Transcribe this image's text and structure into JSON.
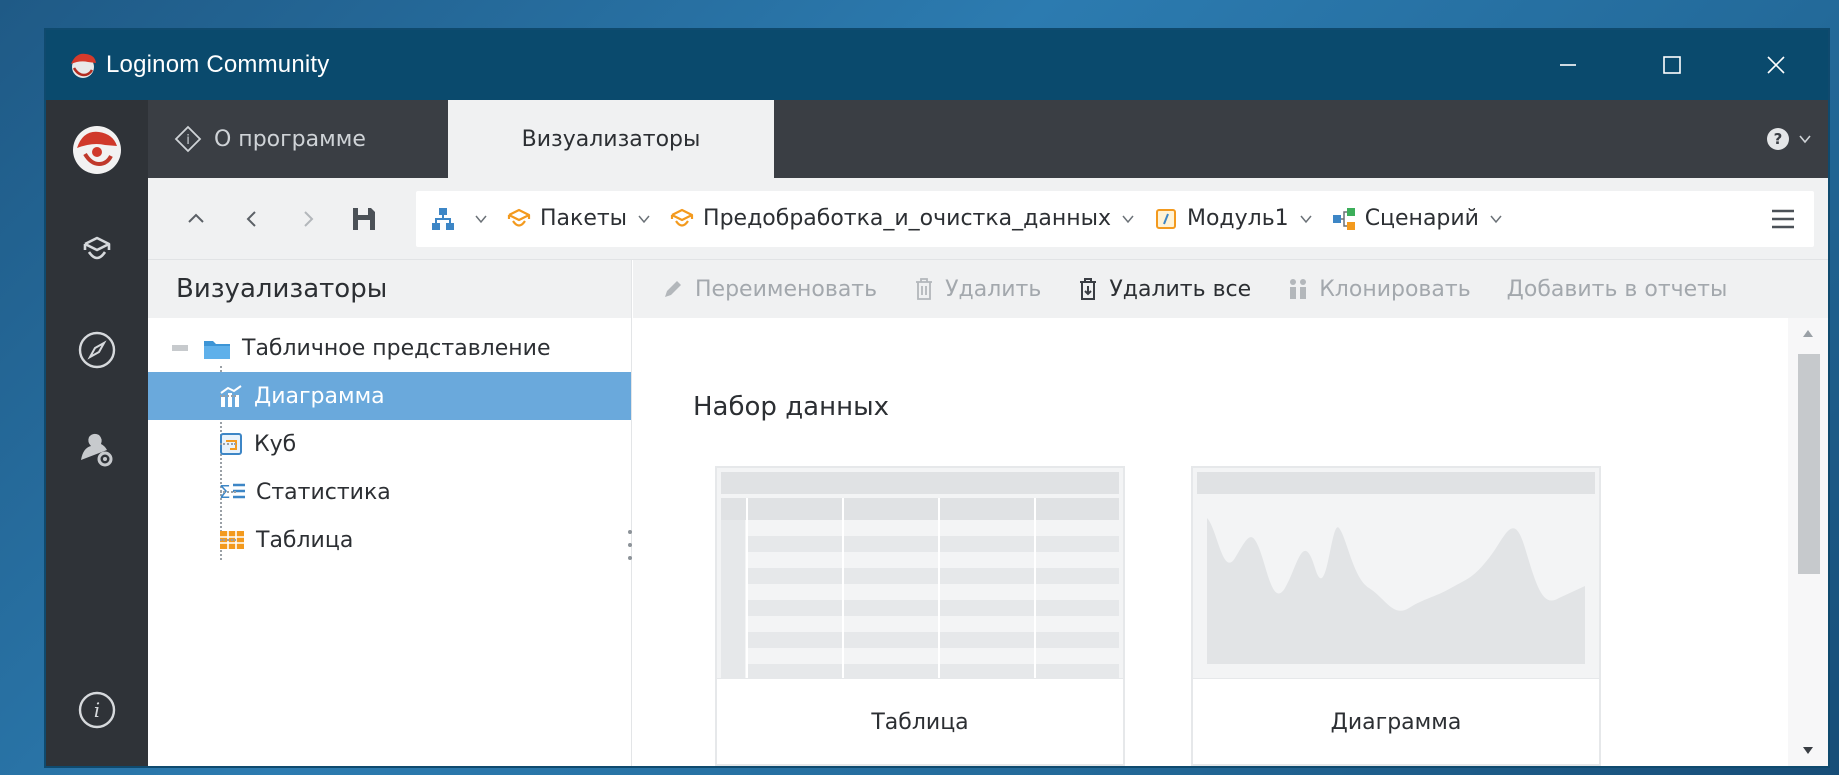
{
  "window": {
    "title": "Loginom Community",
    "controls": {
      "minimize_icon": "minimize-icon",
      "maximize_icon": "maximize-icon",
      "close_icon": "close-icon"
    }
  },
  "rail": {
    "items": [
      {
        "name": "user-avatar",
        "icon": "avatar-icon"
      },
      {
        "name": "packages",
        "icon": "package-icon"
      },
      {
        "name": "navigator",
        "icon": "compass-icon"
      },
      {
        "name": "admin",
        "icon": "user-settings-icon"
      }
    ],
    "bottom": {
      "name": "info",
      "icon": "info-icon"
    }
  },
  "tabs": [
    {
      "label": "О программе",
      "icon": "info-diamond-icon",
      "active": false
    },
    {
      "label": "Визуализаторы",
      "active": true
    }
  ],
  "toolbar": {
    "nav": [
      "up",
      "back",
      "forward",
      "save"
    ],
    "breadcrumbs": [
      {
        "label": "",
        "icon": "hierarchy-icon"
      },
      {
        "label": "Пакеты",
        "icon": "package-icon"
      },
      {
        "label": "Предобработка_и_очистка_данных",
        "icon": "package-icon"
      },
      {
        "label": "Модуль1",
        "icon": "module-icon"
      },
      {
        "label": "Сценарий",
        "icon": "scenario-icon"
      }
    ]
  },
  "left_panel": {
    "title": "Визуализаторы",
    "tree": {
      "root": {
        "label": "Табличное представление",
        "icon": "folder-icon",
        "expanded": true
      },
      "children": [
        {
          "label": "Диаграмма",
          "icon": "chart-icon",
          "selected": true
        },
        {
          "label": "Куб",
          "icon": "cube-icon",
          "selected": false
        },
        {
          "label": "Статистика",
          "icon": "statistics-icon",
          "selected": false
        },
        {
          "label": "Таблица",
          "icon": "table-icon",
          "selected": false
        }
      ]
    }
  },
  "actions": [
    {
      "label": "Переименовать",
      "icon": "pencil-icon",
      "enabled": false
    },
    {
      "label": "Удалить",
      "icon": "trash-icon",
      "enabled": false
    },
    {
      "label": "Удалить все",
      "icon": "trash-all-icon",
      "enabled": true
    },
    {
      "label": "Клонировать",
      "icon": "clone-icon",
      "enabled": false
    },
    {
      "label": "Добавить в отчеты",
      "enabled": false
    }
  ],
  "content": {
    "section_title": "Набор данных",
    "cards": [
      {
        "label": "Таблица",
        "preview": "table-preview"
      },
      {
        "label": "Диаграмма",
        "preview": "chart-preview"
      }
    ]
  },
  "colors": {
    "titlebar": "#0a4a6d",
    "rail": "#2f3338",
    "tabstrip": "#3a3e44",
    "selection": "#6aa9dc",
    "accent_orange": "#f39a1e"
  }
}
